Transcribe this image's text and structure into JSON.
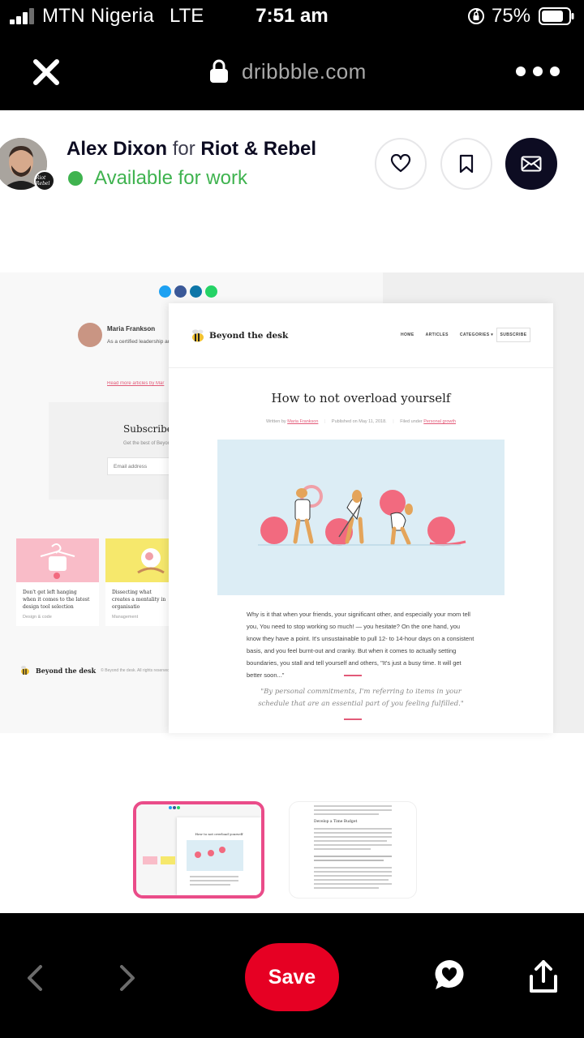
{
  "status_bar": {
    "carrier": "MTN Nigeria",
    "network": "LTE",
    "time": "7:51 am",
    "battery": "75%"
  },
  "address_bar": {
    "url": "dribbble.com"
  },
  "designer": {
    "name": "Alex Dixon",
    "connector": "for",
    "team": "Riot & Rebel",
    "team_badge_text": "Riot Rebel",
    "status": "Available for work",
    "status_color": "#3fb34f"
  },
  "shot": {
    "left_panel": {
      "author_name": "Maria Frankson",
      "author_bio": "As a certified leadership and individuals and organisations transformation. Having he has lived through the trial",
      "author_link": "Read more articles by Mar",
      "subscribe_title": "Subscribe",
      "subscribe_subtitle": "Get the best of Beyon",
      "email_placeholder": "Email address",
      "cards": [
        {
          "title": "Don't get left hanging when it comes to the latest design tool selection",
          "tag": "Design & code",
          "color": "#f9bcc8"
        },
        {
          "title": "Dissecting what creates a mentality in organisatio",
          "tag": "Management",
          "color": "#f6e86c"
        }
      ],
      "footer_logo": "Beyond the desk",
      "footer_copy": "© Beyond the desk. All rights reserved."
    },
    "article": {
      "logo": "Beyond the desk",
      "nav": [
        "HOME",
        "ARTICLES",
        "CATEGORIES ▾"
      ],
      "subscribe_button": "SUBSCRIBE",
      "title": "How to not overload yourself",
      "meta_author_prefix": "Written by",
      "meta_author": "Maria Frankson",
      "meta_date": "Published on May 11, 2018.",
      "meta_filed_prefix": "Filed under",
      "meta_filed": "Personal growth",
      "body": "Why is it that when your friends, your significant other, and especially your mom tell you, You need to stop working so much! — you hesitate? On the one hand, you know they have a point. It's unsustainable to pull 12- to 14-hour days on a consistent basis, and you feel burnt-out and cranky. But when it comes to actually setting boundaries, you stall and tell yourself and others, \"It's just a busy time. It will get better soon...\"",
      "quote": "\"By personal commitments, I'm referring to items in your schedule that are an essential part of you feeling fulfilled.\""
    },
    "accent_color": "#e25a78"
  },
  "thumbnails": {
    "selected_index": 0,
    "selected_border_color": "#ea4c89",
    "mini_title": "How to not overload yourself",
    "second_heading": "Develop a Time Budget"
  },
  "toolbar": {
    "save_label": "Save",
    "save_color": "#e60023"
  },
  "icons": [
    "signal-icon",
    "orientation-lock-icon",
    "battery-icon",
    "close-icon",
    "lock-icon",
    "more-icon",
    "heart-icon",
    "bookmark-icon",
    "mail-icon",
    "back-icon",
    "forward-icon",
    "chat-heart-icon",
    "share-icon"
  ]
}
